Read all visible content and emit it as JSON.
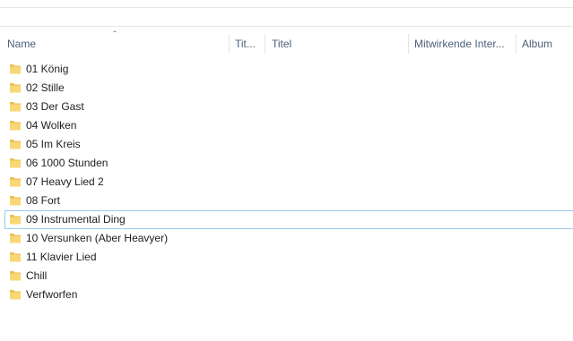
{
  "columns": [
    {
      "key": "name",
      "label": "Name"
    },
    {
      "key": "tit",
      "label": "Tit..."
    },
    {
      "key": "titel",
      "label": "Titel"
    },
    {
      "key": "mitwirkende",
      "label": "Mitwirkende Inter..."
    },
    {
      "key": "album",
      "label": "Album"
    }
  ],
  "sort": {
    "column": "name",
    "direction": "ascending",
    "icon": "chevron-up-icon"
  },
  "folder_color": "#f8d775",
  "items": [
    {
      "label": "01 König"
    },
    {
      "label": "02 Stille"
    },
    {
      "label": "03 Der Gast"
    },
    {
      "label": "04 Wolken"
    },
    {
      "label": "05 Im Kreis"
    },
    {
      "label": "06 1000 Stunden"
    },
    {
      "label": "07 Heavy Lied 2"
    },
    {
      "label": "08 Fort"
    },
    {
      "label": "09 Instrumental Ding",
      "focused": true
    },
    {
      "label": "10 Versunken (Aber Heavyer)"
    },
    {
      "label": "11 Klavier Lied"
    },
    {
      "label": "Chill"
    },
    {
      "label": "Verfworfen"
    }
  ]
}
